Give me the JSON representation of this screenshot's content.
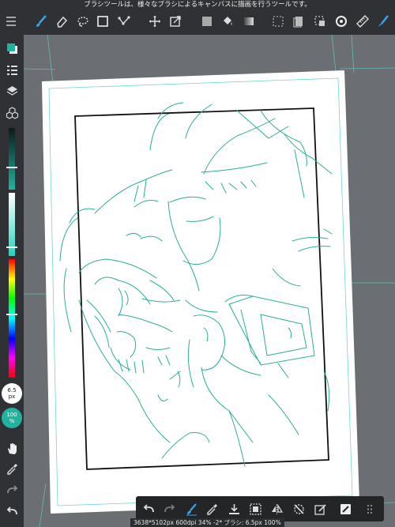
{
  "top_hint": "ブラシツールは、様々なブラシによるキャンバスに描画を行うツールです。",
  "sidebar": {
    "brush_size": "6.5",
    "brush_size_unit": "px",
    "opacity": "100",
    "opacity_unit": "%"
  },
  "status_text": "3638*5102px 600dpi 34% -2* ブラシ: 6.5px 100%",
  "colors": {
    "accent": "#21b3a0",
    "toolbar": "#2f3134",
    "canvas": "#6b6e72"
  }
}
